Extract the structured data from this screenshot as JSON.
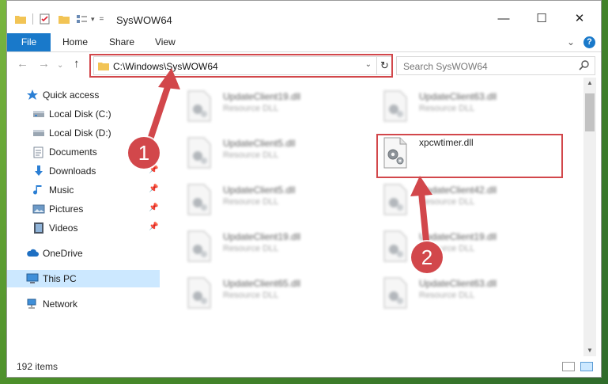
{
  "window": {
    "title": "SysWOW64",
    "controls": {
      "minimize": "—",
      "maximize": "☐",
      "close": "✕"
    }
  },
  "ribbon": {
    "tabs": [
      "File",
      "Home",
      "Share",
      "View"
    ],
    "help": "?"
  },
  "address_bar": {
    "path": "C:\\Windows\\SysWOW64",
    "dropdown": "⌄",
    "refresh": "↻"
  },
  "search": {
    "placeholder": "Search SysWOW64"
  },
  "sidebar": {
    "items": [
      {
        "label": "Quick access",
        "icon": "star-icon",
        "pinned": false
      },
      {
        "label": "Local Disk (C:)",
        "icon": "drive-icon",
        "pinned": false
      },
      {
        "label": "Local Disk (D:)",
        "icon": "drive-icon",
        "pinned": false
      },
      {
        "label": "Documents",
        "icon": "documents-icon",
        "pinned": false
      },
      {
        "label": "Downloads",
        "icon": "download-icon",
        "pinned": true
      },
      {
        "label": "Music",
        "icon": "music-icon",
        "pinned": true
      },
      {
        "label": "Pictures",
        "icon": "pictures-icon",
        "pinned": true
      },
      {
        "label": "Videos",
        "icon": "videos-icon",
        "pinned": true
      },
      {
        "label": "OneDrive",
        "icon": "cloud-icon",
        "pinned": false
      },
      {
        "label": "This PC",
        "icon": "computer-icon",
        "pinned": false,
        "selected": true
      },
      {
        "label": "Network",
        "icon": "network-icon",
        "pinned": false
      }
    ],
    "pin_glyph": "📌"
  },
  "files": [
    {
      "name": "UpdateClient19.dll",
      "type": "Resource DLL"
    },
    {
      "name": "UpdateClient63.dll",
      "type": "Resource DLL"
    },
    {
      "name": "UpdateClient5.dll",
      "type": "Resource DLL"
    },
    {
      "name": "xpcwtimer.dll",
      "type": ""
    },
    {
      "name": "UpdateClient5.dll",
      "type": "Resource DLL"
    },
    {
      "name": "UpdateClient42.dll",
      "type": "Resource DLL"
    },
    {
      "name": "UpdateClient19.dll",
      "type": "Resource DLL"
    },
    {
      "name": "UpdateClient19.dll",
      "type": "Resource DLL"
    },
    {
      "name": "UpdateClient65.dll",
      "type": "Resource DLL"
    },
    {
      "name": "UpdateClient63.dll",
      "type": "Resource DLL"
    }
  ],
  "status": {
    "item_count": "192 items"
  },
  "annotations": {
    "step1": "1",
    "step2": "2"
  },
  "colors": {
    "accent": "#1979ca",
    "highlight": "#d2474b",
    "selected": "#cce8ff"
  }
}
